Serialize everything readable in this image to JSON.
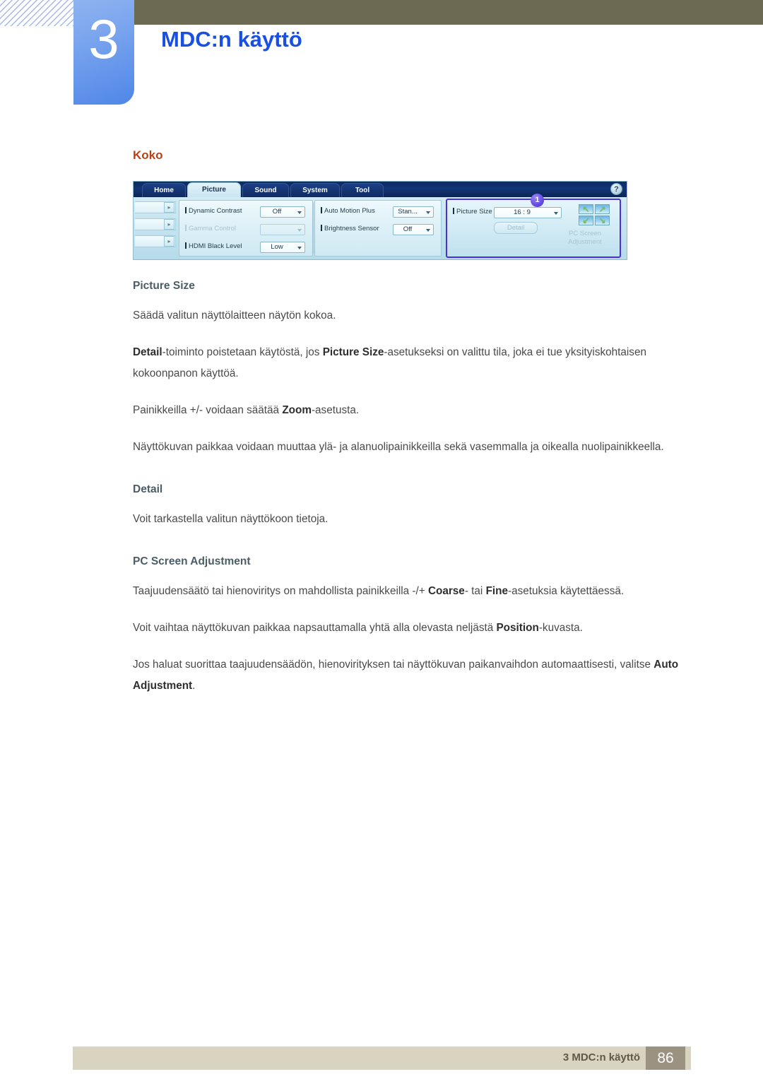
{
  "header": {
    "chapter_number": "3",
    "chapter_title": "MDC:n käyttö"
  },
  "content": {
    "section_heading": "Koko",
    "sub_heading_picture_size": "Picture Size",
    "par_picture_size_1": "Säädä valitun näyttölaitteen näytön kokoa.",
    "par_picture_size_2_a": "Detail",
    "par_picture_size_2_b": "-toiminto poistetaan käytöstä, jos ",
    "par_picture_size_2_c": "Picture Size",
    "par_picture_size_2_d": "-asetukseksi on valittu tila, joka ei tue yksityiskohtaisen kokoonpanon käyttöä.",
    "par_picture_size_3_a": "Painikkeilla +/- voidaan säätää ",
    "par_picture_size_3_b": "Zoom",
    "par_picture_size_3_c": "-asetusta.",
    "par_picture_size_4": "Näyttökuvan paikkaa voidaan muuttaa ylä- ja alanuolipainikkeilla sekä vasemmalla ja oikealla nuolipainikkeella.",
    "sub_heading_detail": "Detail",
    "par_detail_1": "Voit tarkastella valitun näyttökoon tietoja.",
    "sub_heading_pc_screen": "PC Screen Adjustment",
    "par_pc_1_a": "Taajuudensäätö tai hienoviritys on mahdollista painikkeilla -/+ ",
    "par_pc_1_b": "Coarse",
    "par_pc_1_c": "- tai ",
    "par_pc_1_d": "Fine",
    "par_pc_1_e": "-asetuksia käytettäessä.",
    "par_pc_2_a": "Voit vaihtaa näyttökuvan paikkaa napsauttamalla yhtä alla olevasta neljästä ",
    "par_pc_2_b": "Position",
    "par_pc_2_c": "-kuvasta.",
    "par_pc_3_a": "Jos haluat suorittaa taajuudensäädön, hienovirityksen tai näyttökuvan paikanvaihdon automaattisesti, valitse ",
    "par_pc_3_b": "Auto Adjustment",
    "par_pc_3_c": "."
  },
  "mdc": {
    "tabs": [
      {
        "label": "Home",
        "active": false
      },
      {
        "label": "Picture",
        "active": true
      },
      {
        "label": "Sound",
        "active": false
      },
      {
        "label": "System",
        "active": false
      },
      {
        "label": "Tool",
        "active": false
      }
    ],
    "help_label": "?",
    "controls": {
      "dynamic_contrast_label": "Dynamic Contrast",
      "dynamic_contrast_value": "Off",
      "gamma_control_label": "Gamma Control",
      "gamma_control_value": "",
      "hdmi_black_level_label": "HDMI Black Level",
      "hdmi_black_level_value": "Low",
      "auto_motion_plus_label": "Auto Motion Plus",
      "auto_motion_plus_value": "Stan...",
      "brightness_sensor_label": "Brightness Sensor",
      "brightness_sensor_value": "Off",
      "picture_size_label": "Picture Size",
      "picture_size_value": "16 : 9",
      "detail_button_label": "Detail",
      "pc_screen_caption": "PC Screen Adjustment",
      "callout_badge": "1"
    },
    "colors": {
      "callout_badge": "#4c2fd0",
      "highlight_border": "#4a2fe0",
      "tab_active_bg": "#c9e6f1",
      "tabbar_bg": "#123575"
    }
  },
  "footer": {
    "text": "3 MDC:n käyttö",
    "page_number": "86"
  },
  "theme": {
    "heading_orange": "#c03f12",
    "chapter_blue": "#1a50e2",
    "olive": "#6d6a54",
    "footer_bg": "#d8d4c0",
    "footer_page_bg": "#9c9281"
  }
}
